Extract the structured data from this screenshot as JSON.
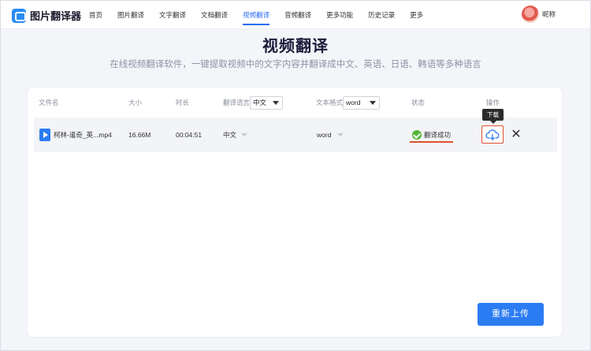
{
  "app": {
    "name": "图片翻译器"
  },
  "nav": {
    "items": [
      {
        "label": "首页"
      },
      {
        "label": "图片翻译"
      },
      {
        "label": "文字翻译"
      },
      {
        "label": "文档翻译"
      },
      {
        "label": "视频翻译",
        "active": true
      },
      {
        "label": "音频翻译"
      },
      {
        "label": "更多功能"
      },
      {
        "label": "历史记录"
      },
      {
        "label": "更多"
      }
    ]
  },
  "user": {
    "name": "昵称"
  },
  "page": {
    "title": "视频翻译",
    "subtitle": "在线视频翻译软件，一键提取视频中的文字内容并翻译成中文、英语、日语、韩语等多种语言"
  },
  "table": {
    "headers": {
      "filename": "文件名",
      "size": "大小",
      "duration": "时长",
      "language": "翻译语言",
      "language_select": "中文",
      "format": "文本格式",
      "format_select": "word",
      "status": "状态",
      "actions": "操作"
    },
    "rows": [
      {
        "filename": "柯林-遣奇_英...",
        "ext": ".mp4",
        "size": "16.66M",
        "duration": "00:04:51",
        "language": "中文",
        "format": "word",
        "status": "翻译成功"
      }
    ]
  },
  "tooltip": {
    "download": "下载"
  },
  "actions": {
    "reupload": "重新上传"
  },
  "colors": {
    "accent": "#2b7cf3",
    "success": "#52b437",
    "highlight": "#e0502f"
  }
}
